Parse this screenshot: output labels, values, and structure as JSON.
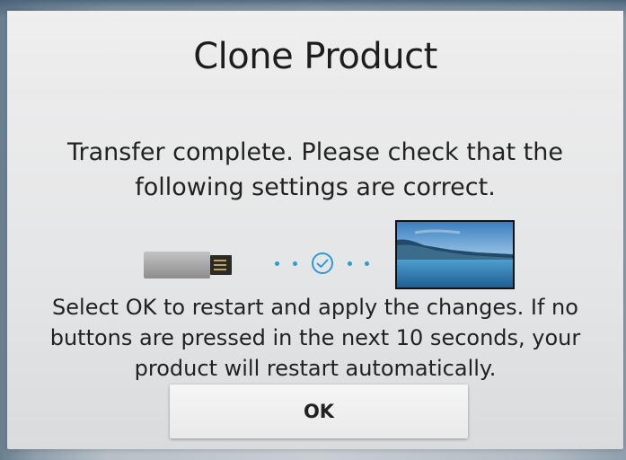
{
  "dialog": {
    "title": "Clone Product",
    "message": "Transfer complete. Please check that the following settings are correct.",
    "note": "Select OK to restart and apply the changes. If no buttons are pressed in the next 10 seconds, your product will restart automatically.",
    "ok_label": "OK"
  },
  "illustration": {
    "source_icon": "usb-drive-icon",
    "status_icon": "check-circle-icon",
    "target_icon": "tv-icon"
  },
  "colors": {
    "accent": "#2a9ad8",
    "dialog_background": "#e9e9ea",
    "text": "#222222"
  }
}
